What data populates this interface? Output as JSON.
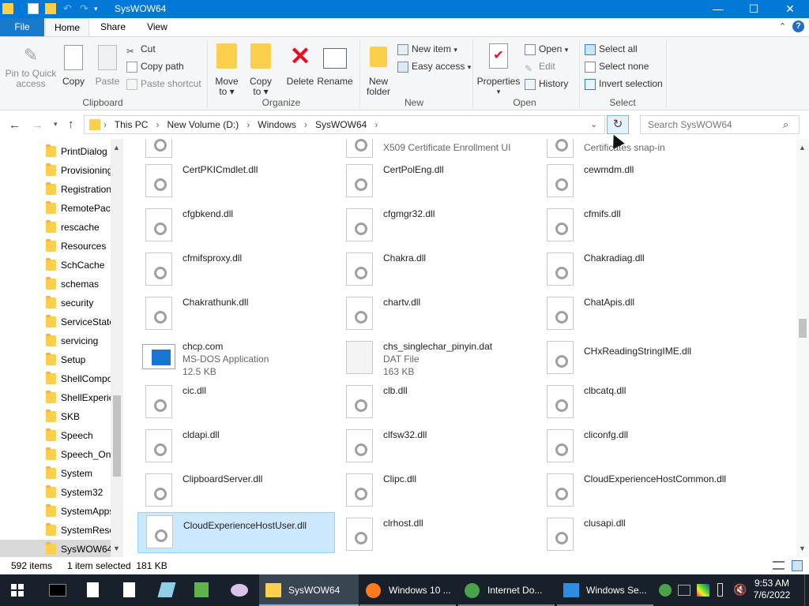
{
  "window": {
    "title": "SysWOW64",
    "controls": {
      "minimize": "—",
      "maximize": "☐",
      "close": "✕"
    }
  },
  "tabs": {
    "file": "File",
    "items": [
      "Home",
      "Share",
      "View"
    ],
    "active": "Home"
  },
  "ribbon": {
    "clipboard": {
      "pin": "Pin to Quick access",
      "pin_l1": "Pin to Quick",
      "pin_l2": "access",
      "copy": "Copy",
      "paste": "Paste",
      "cut": "Cut",
      "copy_path": "Copy path",
      "paste_shortcut": "Paste shortcut",
      "group": "Clipboard"
    },
    "organize": {
      "move_l1": "Move",
      "move_l2": "to",
      "copy_l1": "Copy",
      "copy_l2": "to",
      "delete": "Delete",
      "rename": "Rename",
      "group": "Organize"
    },
    "new": {
      "folder_l1": "New",
      "folder_l2": "folder",
      "new_item": "New item",
      "easy_access": "Easy access",
      "group": "New"
    },
    "open": {
      "properties": "Properties",
      "open": "Open",
      "edit": "Edit",
      "history": "History",
      "group": "Open"
    },
    "select": {
      "select_all": "Select all",
      "select_none": "Select none",
      "invert": "Invert selection",
      "group": "Select"
    }
  },
  "address": {
    "crumbs": [
      "This PC",
      "New Volume (D:)",
      "Windows",
      "SysWOW64"
    ],
    "search_placeholder": "Search SysWOW64"
  },
  "nav_pane": {
    "items": [
      "PrintDialog",
      "Provisioning",
      "Registration",
      "RemotePackages",
      "rescache",
      "Resources",
      "SchCache",
      "schemas",
      "security",
      "ServiceState",
      "servicing",
      "Setup",
      "ShellComponents",
      "ShellExperiences",
      "SKB",
      "Speech",
      "Speech_OneCore",
      "System",
      "System32",
      "SystemApps",
      "SystemResources",
      "SysWOW64"
    ],
    "visible": [
      "PrintDialog",
      "Provisioning",
      "Registration",
      "RemotePacl",
      "rescache",
      "Resources",
      "SchCache",
      "schemas",
      "security",
      "ServiceState",
      "servicing",
      "Setup",
      "ShellCompo",
      "ShellExperie",
      "SKB",
      "Speech",
      "Speech_One",
      "System",
      "System32",
      "SystemApps",
      "SystemReso",
      "SysWOW64"
    ],
    "selected": "SysWOW64"
  },
  "files": {
    "partial": [
      "",
      "X509 Certificate Enrollment UI",
      "Certificates snap-in"
    ],
    "rows": [
      [
        "CertPKICmdlet.dll",
        "CertPolEng.dll",
        "cewmdm.dll"
      ],
      [
        "cfgbkend.dll",
        "cfgmgr32.dll",
        "cfmifs.dll"
      ],
      [
        "cfmifsproxy.dll",
        "Chakra.dll",
        "Chakradiag.dll"
      ],
      [
        "Chakrathunk.dll",
        "chartv.dll",
        "ChatApis.dll"
      ],
      [
        "chcp.com",
        "chs_singlechar_pinyin.dat",
        "CHxReadingStringIME.dll"
      ],
      [
        "cic.dll",
        "clb.dll",
        "clbcatq.dll"
      ],
      [
        "cldapi.dll",
        "clfsw32.dll",
        "cliconfg.dll"
      ],
      [
        "ClipboardServer.dll",
        "Clipc.dll",
        "CloudExperienceHostCommon.dll"
      ],
      [
        "CloudExperienceHostUser.dll",
        "clrhost.dll",
        "clusapi.dll"
      ]
    ],
    "details": {
      "chcp_type": "MS-DOS Application",
      "chcp_size": "12.5 KB",
      "chs_type": "DAT File",
      "chs_size": "163 KB"
    },
    "selected": "CloudExperienceHostUser.dll"
  },
  "status": {
    "count": "592 items",
    "selection": "1 item selected  181 KB"
  },
  "taskbar": {
    "tasks": [
      {
        "label": "SysWOW64",
        "icon": "folder-icon",
        "active": true
      },
      {
        "label": "Windows 10 ...",
        "icon": "firefox-icon",
        "active": false
      },
      {
        "label": "Internet Do...",
        "icon": "globe-icon",
        "active": false
      },
      {
        "label": "Windows Se...",
        "icon": "window-icon",
        "active": false
      }
    ],
    "time": "9:53 AM",
    "date": "7/6/2022"
  },
  "colors": {
    "titlebar": "#0078d7",
    "selection": "#cce8ff",
    "taskbar": "#18212b"
  }
}
